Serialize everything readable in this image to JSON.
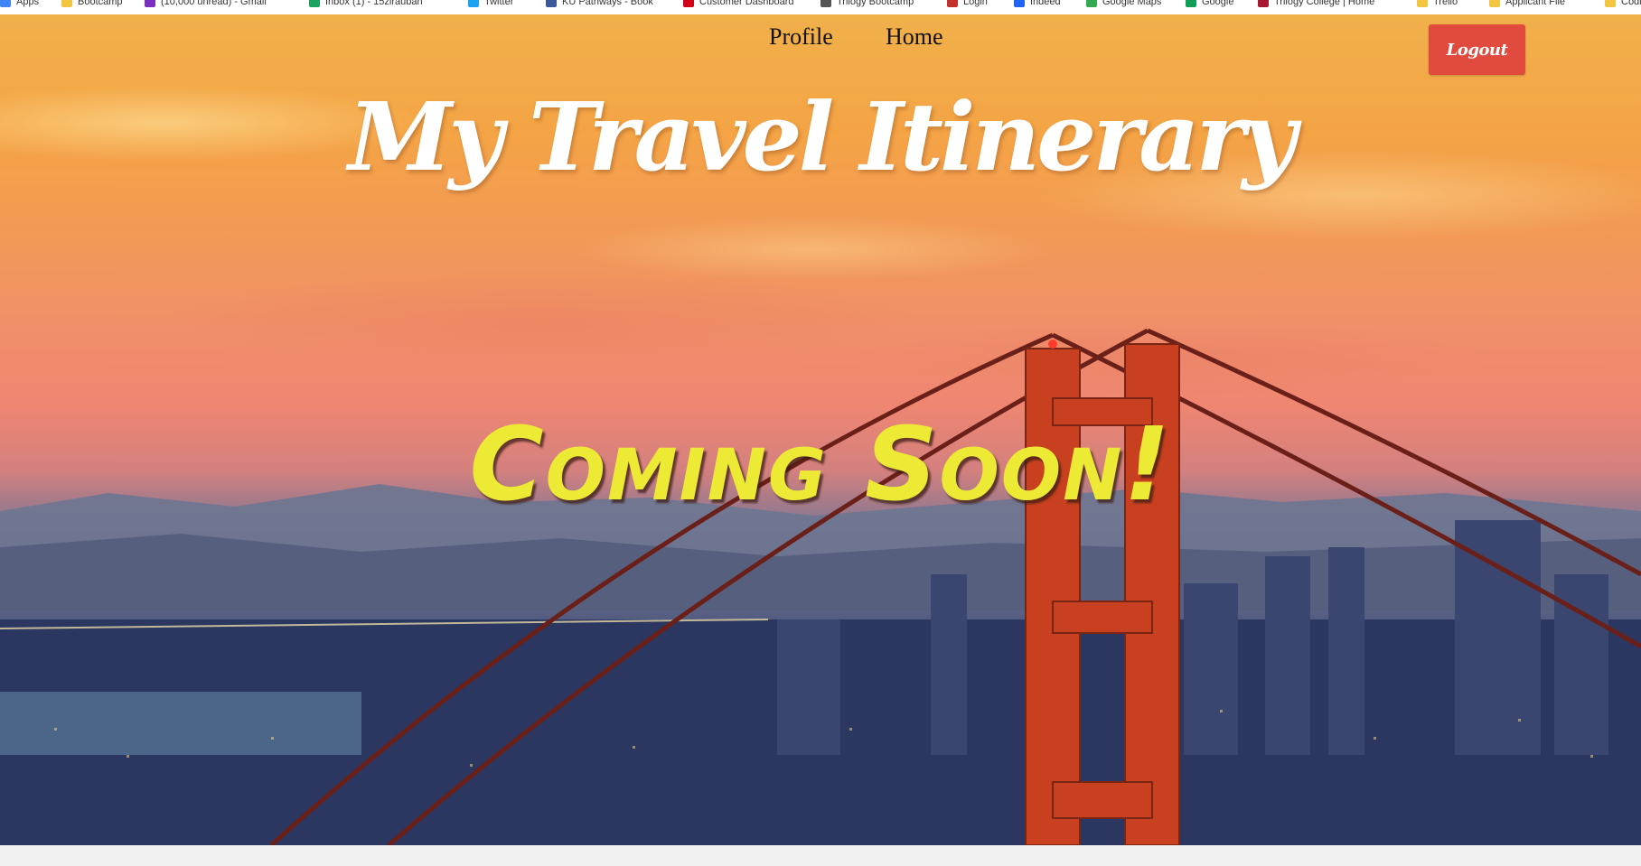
{
  "bookmarks": [
    {
      "label": "Apps",
      "color": "#4285f4"
    },
    {
      "label": "Bootcamp",
      "color": "#f4c542"
    },
    {
      "label": "(10,000 unread) - Gmail",
      "color": "#7b2fbf"
    },
    {
      "label": "Inbox (1) - 15zirauban",
      "color": "#1aa260"
    },
    {
      "label": "Twitter",
      "color": "#1da1f2"
    },
    {
      "label": "KU Pathways - Book",
      "color": "#3b5998"
    },
    {
      "label": "Customer Dashboard",
      "color": "#d0021b"
    },
    {
      "label": "Trilogy Bootcamp",
      "color": "#555555"
    },
    {
      "label": "Login",
      "color": "#c4302b"
    },
    {
      "label": "Indeed",
      "color": "#2164f3"
    },
    {
      "label": "Google Maps",
      "color": "#34a853"
    },
    {
      "label": "Google",
      "color": "#0f9d58"
    },
    {
      "label": "Trilogy College | Home",
      "color": "#a6192e"
    },
    {
      "label": "Trello",
      "color": "#f4c542"
    },
    {
      "label": "Applicant File",
      "color": "#f4c542"
    },
    {
      "label": "Coding",
      "color": "#f4c542"
    }
  ],
  "nav": {
    "profile_label": "Profile",
    "home_label": "Home",
    "logout_label": "Logout"
  },
  "hero": {
    "title": "My Travel Itinerary",
    "subtitle": "Coming Soon!",
    "title_color": "#ffffff",
    "subtitle_color": "#ecea35"
  },
  "colors": {
    "logout_button": "#e04a3f",
    "bridge": "#c8401f"
  }
}
